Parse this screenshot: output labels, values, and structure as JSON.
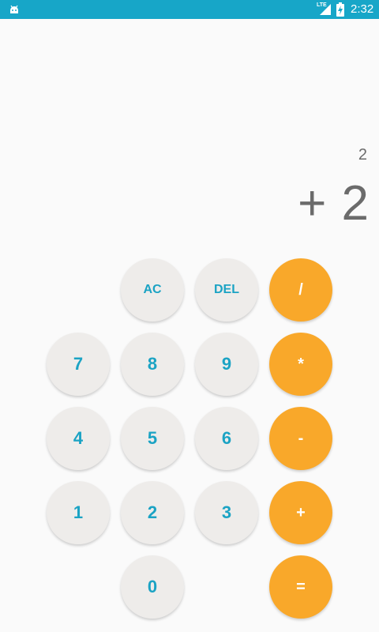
{
  "status_bar": {
    "network_label": "LTE",
    "time": "2:32"
  },
  "display": {
    "history": "2",
    "expression": "+ 2"
  },
  "keys": {
    "ac": "AC",
    "del": "DEL",
    "divide": "/",
    "seven": "7",
    "eight": "8",
    "nine": "9",
    "multiply": "*",
    "four": "4",
    "five": "5",
    "six": "6",
    "minus": "-",
    "one": "1",
    "two": "2",
    "three": "3",
    "plus": "+",
    "zero": "0",
    "equals": "="
  },
  "colors": {
    "status_bar": "#17a6c8",
    "key_background": "#eeecea",
    "key_text": "#1ba3c4",
    "operator_background": "#f9a82a"
  }
}
